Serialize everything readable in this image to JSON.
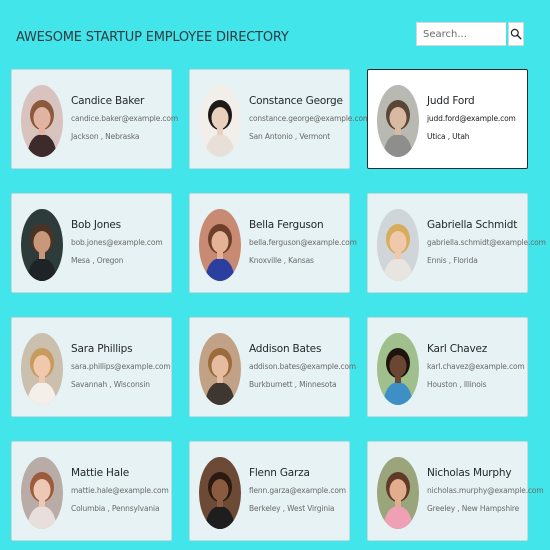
{
  "header": {
    "title": "AWESOME STARTUP EMPLOYEE DIRECTORY"
  },
  "search": {
    "placeholder": "Search...",
    "value": "",
    "button_icon": "search-icon"
  },
  "colors": {
    "page_background": "#41e5ea",
    "card_background": "#e6f2f3",
    "active_card_background": "#ffffff",
    "active_card_border": "#2b2b2b"
  },
  "employees": [
    {
      "name": "Candice Baker",
      "email": "candice.baker@example.com",
      "location": "Jackson , Nebraska",
      "photo": "avatar-photo",
      "active": false
    },
    {
      "name": "Constance George",
      "email": "constance.george@example.com",
      "location": "San Antonio , Vermont",
      "photo": "avatar-photo",
      "active": false
    },
    {
      "name": "Judd Ford",
      "email": "judd.ford@example.com",
      "location": "Utica , Utah",
      "photo": "avatar-photo",
      "active": true
    },
    {
      "name": "Bob Jones",
      "email": "bob.jones@example.com",
      "location": "Mesa , Oregon",
      "photo": "avatar-photo",
      "active": false
    },
    {
      "name": "Bella Ferguson",
      "email": "bella.ferguson@example.com",
      "location": "Knoxville , Kansas",
      "photo": "avatar-photo",
      "active": false
    },
    {
      "name": "Gabriella Schmidt",
      "email": "gabriella.schmidt@example.com",
      "location": "Ennis , Florida",
      "photo": "avatar-photo",
      "active": false
    },
    {
      "name": "Sara Phillips",
      "email": "sara.phillips@example.com",
      "location": "Savannah , Wisconsin",
      "photo": "avatar-photo",
      "active": false
    },
    {
      "name": "Addison Bates",
      "email": "addison.bates@example.com",
      "location": "Burkburnett , Minnesota",
      "photo": "avatar-photo",
      "active": false
    },
    {
      "name": "Karl Chavez",
      "email": "karl.chavez@example.com",
      "location": "Houston , Illinois",
      "photo": "avatar-photo",
      "active": false
    },
    {
      "name": "Mattie Hale",
      "email": "mattie.hale@example.com",
      "location": "Columbia , Pennsylvania",
      "photo": "avatar-photo",
      "active": false
    },
    {
      "name": "Flenn Garza",
      "email": "flenn.garza@example.com",
      "location": "Berkeley , West Virginia",
      "photo": "avatar-photo",
      "active": false
    },
    {
      "name": "Nicholas Murphy",
      "email": "nicholas.murphy@example.com",
      "location": "Greeley , New Hampshire",
      "photo": "avatar-photo",
      "active": false
    }
  ]
}
